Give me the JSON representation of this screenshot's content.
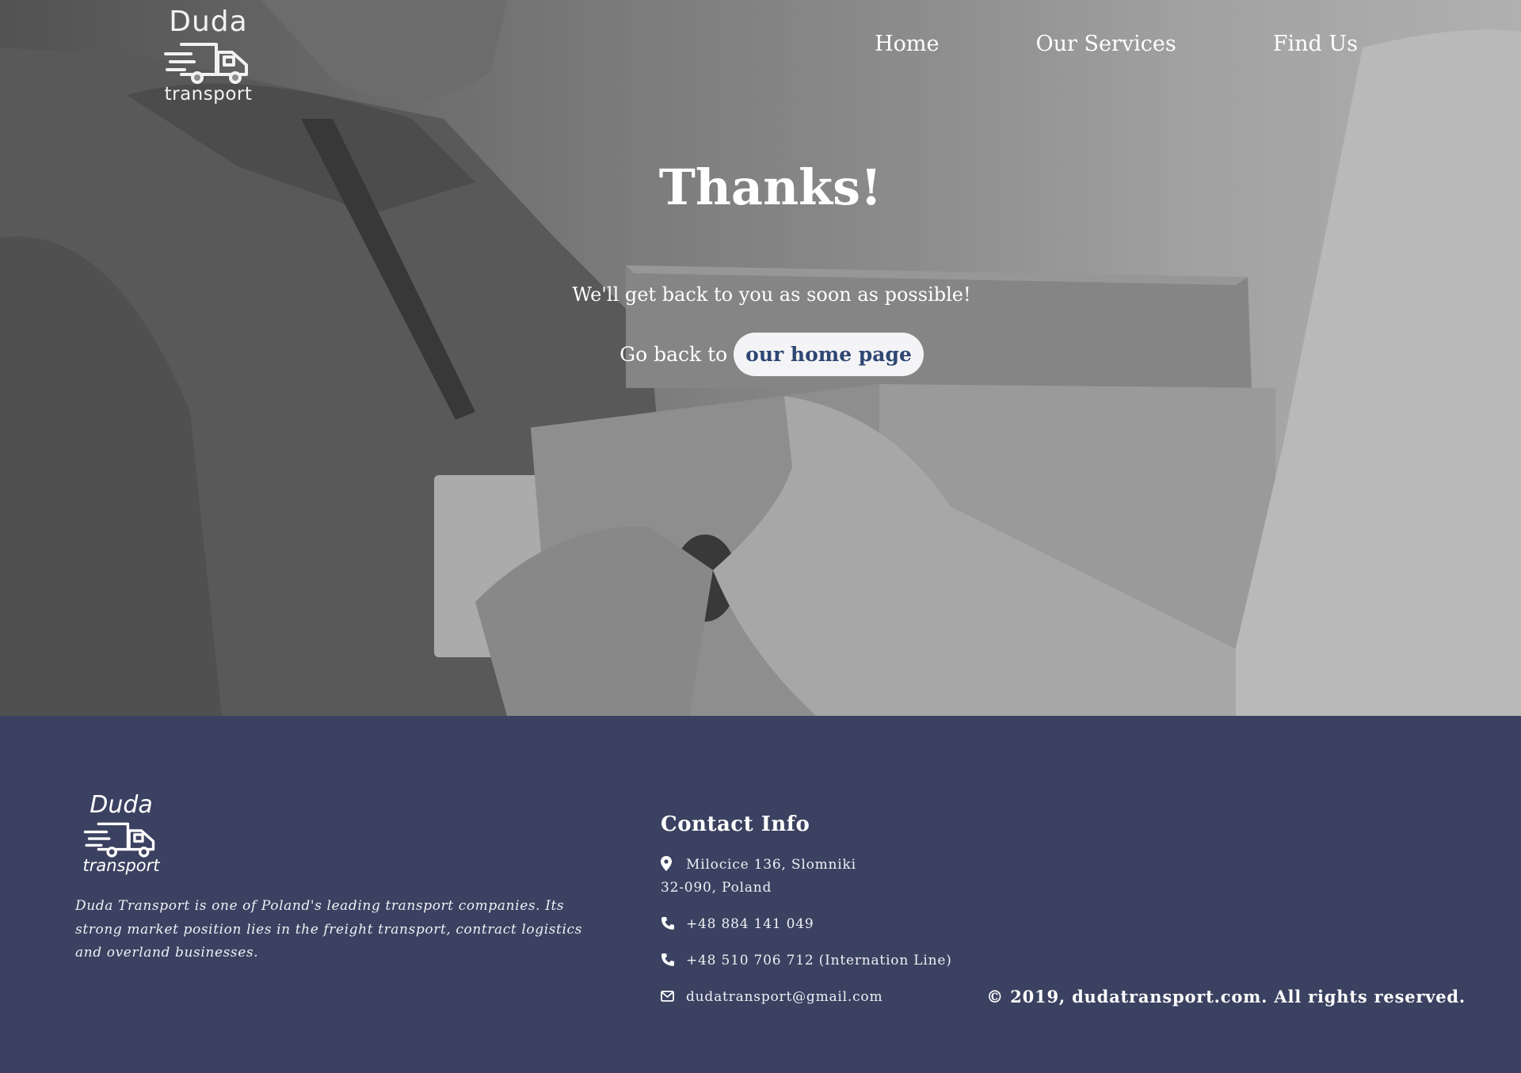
{
  "header": {
    "logo": {
      "line1": "Duda",
      "line2": "transport"
    },
    "nav": [
      "Home",
      "Our Services",
      "Find Us"
    ]
  },
  "hero": {
    "title": "Thanks!",
    "subtitle": "We'll get back to you as soon as possible!",
    "back_prefix": "Go back to",
    "home_link": "our home page"
  },
  "footer": {
    "logo": {
      "line1": "Duda",
      "line2": "transport"
    },
    "description": "Duda Transport is one of Poland's leading transport companies. Its strong market position lies in the freight transport, contract logistics and overland businesses.",
    "contact": {
      "heading": "Contact Info",
      "address_line1": "Milocice 136, Slomniki",
      "address_line2": "32-090, Poland",
      "phone1": "+48 884 141 049",
      "phone2": "+48 510 706 712 (Internation Line)",
      "email": "dudatransport@gmail.com"
    },
    "copyright": "© 2019, dudatransport.com. All rights reserved."
  },
  "colors": {
    "footer_bg": "#3b4160",
    "link_text": "#2e4673"
  }
}
